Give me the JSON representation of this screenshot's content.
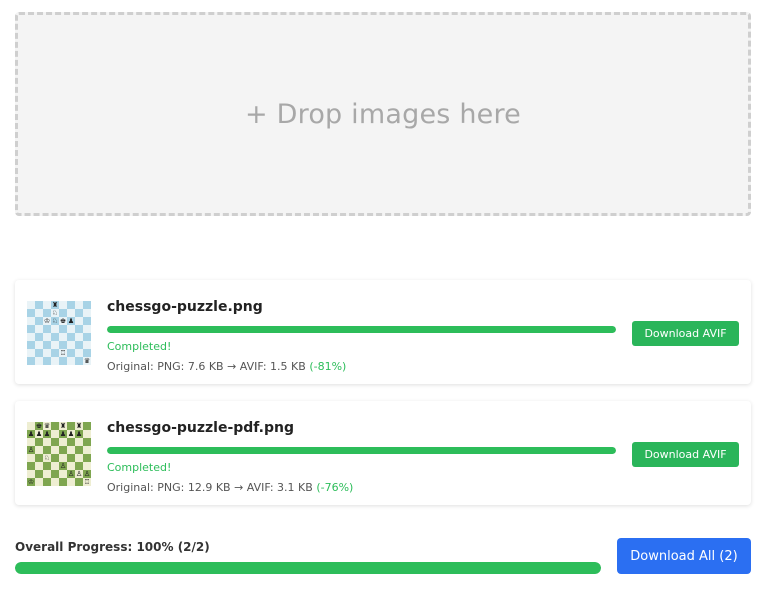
{
  "dropzone": {
    "text": "+ Drop images here"
  },
  "files": [
    {
      "name": "chessgo-puzzle.png",
      "progress": 1.0,
      "status": "Completed!",
      "stats_prefix": "Original: PNG: 7.6 KB → AVIF: 1.5 KB",
      "reduction": "(-81%)",
      "button_label": "Download AVIF",
      "thumb_palette": {
        "light": "#e9f3f7",
        "dark": "#a8d3e6"
      },
      "pieces": [
        "",
        "",
        "",
        "♜",
        "",
        "",
        "",
        "",
        "",
        "",
        "",
        "♘",
        "",
        "",
        "",
        "",
        "",
        "",
        "♔",
        "♘",
        "♚",
        "♟",
        "",
        "",
        "",
        "",
        "",
        "",
        "",
        "",
        "",
        "",
        "",
        "",
        "",
        "",
        "",
        "",
        "",
        "",
        "",
        "",
        "",
        "",
        "",
        "",
        "",
        "",
        "",
        "",
        "",
        "",
        "♖",
        "",
        "",
        "",
        "",
        "",
        "",
        "",
        "",
        "",
        "",
        "♛"
      ]
    },
    {
      "name": "chessgo-puzzle-pdf.png",
      "progress": 1.0,
      "status": "Completed!",
      "stats_prefix": "Original: PNG: 12.9 KB → AVIF: 3.1 KB",
      "reduction": "(-76%)",
      "button_label": "Download AVIF",
      "thumb_palette": {
        "light": "#eeeed2",
        "dark": "#7fa650"
      },
      "pieces": [
        "",
        "♚",
        "♛",
        "",
        "♜",
        "",
        "♜",
        "",
        "♟",
        "♟",
        "♟",
        "",
        "♟",
        "♟",
        "♟",
        "",
        "",
        "",
        "",
        "",
        "",
        "",
        "",
        "",
        "♙",
        "",
        "",
        "",
        "",
        "",
        "",
        "",
        "",
        "",
        "♘",
        "",
        "",
        "",
        "",
        "",
        "",
        "",
        "",
        "",
        "♙",
        "",
        "",
        "",
        "",
        "",
        "",
        "",
        "",
        "♙",
        "♙",
        "♙",
        "♔",
        "",
        "",
        "",
        "",
        "",
        "",
        "♖"
      ]
    }
  ],
  "overall": {
    "label": "Overall Progress: 100% (2/2)",
    "progress": 1.0
  },
  "download_all": {
    "label": "Download All (2)"
  },
  "colors": {
    "green": "#2dbd5a",
    "blue": "#2b6ff2"
  }
}
